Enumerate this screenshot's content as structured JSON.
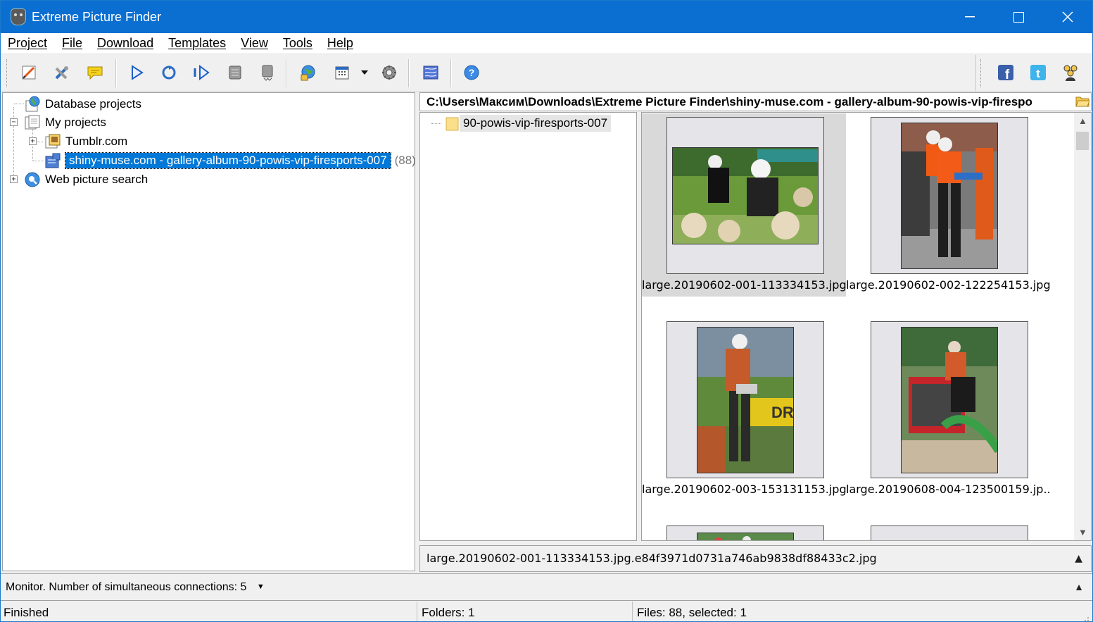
{
  "window": {
    "title": "Extreme Picture Finder"
  },
  "menu": [
    "Project",
    "File",
    "Download",
    "Templates",
    "View",
    "Tools",
    "Help"
  ],
  "toolbar": {
    "icons": [
      "edit-project-icon",
      "tools-icon",
      "comment-icon",
      "play-icon",
      "refresh-icon",
      "next-icon",
      "stop-icon",
      "queue-icon",
      "web-globe-icon",
      "calendar-icon",
      "settings-icon",
      "database-icon",
      "help-icon"
    ],
    "social": [
      "facebook-icon",
      "twitter-icon",
      "community-icon"
    ]
  },
  "tree": {
    "database_projects": "Database projects",
    "my_projects": "My projects",
    "tumblr": "Tumblr.com",
    "selected_project": "shiny-muse.com - gallery-album-90-powis-vip-firesports-007",
    "selected_count": "(88)",
    "web_search": "Web picture search"
  },
  "path": "C:\\Users\\Максим\\Downloads\\Extreme Picture Finder\\shiny-muse.com - gallery-album-90-powis-vip-firespo",
  "folder": "90-powis-vip-firesports-007",
  "thumbnails": [
    {
      "label": "large.20190602-001-113334153.jpg...",
      "selected": true
    },
    {
      "label": "large.20190602-002-122254153.jpg...",
      "selected": false
    },
    {
      "label": "large.20190602-003-153131153.jpg...",
      "selected": false
    },
    {
      "label": "large.20190608-004-123500159.jp...",
      "selected": false
    }
  ],
  "info_filename": "large.20190602-001-113334153.jpg.e84f3971d0731a746ab9838df88433c2.jpg",
  "monitor_text": "Monitor. Number of simultaneous connections: 5",
  "status": {
    "state": "Finished",
    "folders": "Folders: 1",
    "files": "Files: 88, selected: 1"
  },
  "colors": {
    "titlebar": "#0b6fd1",
    "selection": "#0078d7"
  }
}
